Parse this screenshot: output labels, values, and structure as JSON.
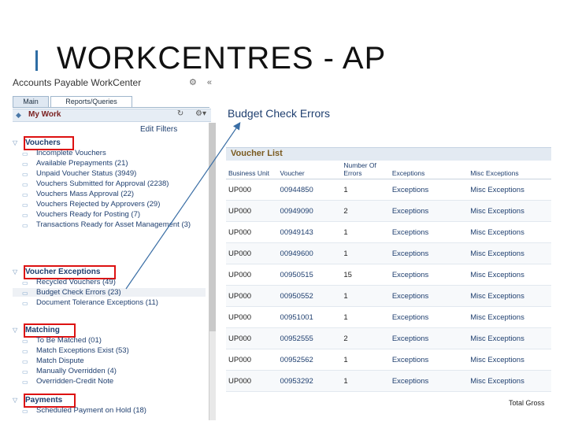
{
  "slide": {
    "title": "WORKCENTRES - AP"
  },
  "workcenter": {
    "title": "Accounts Payable WorkCenter",
    "tools": [
      "⚙",
      "«"
    ],
    "tabs": [
      "Main",
      "Reports/Queries"
    ],
    "my_work": "My Work",
    "my_work_tools": [
      "↻",
      "⚙▾"
    ],
    "edit_filters": "Edit Filters",
    "sections": [
      {
        "label": "Vouchers",
        "items": [
          "Incomplete Vouchers",
          "Available Prepayments (21)",
          "Unpaid Voucher Status (3949)",
          "Vouchers Submitted for Approval (2238)",
          "Vouchers Mass Approval (22)",
          "Vouchers Rejected by Approvers (29)",
          "Vouchers Ready for Posting (7)",
          "Transactions Ready for Asset Management (3)"
        ]
      },
      {
        "label": "Voucher Exceptions",
        "items": [
          "Recycled Vouchers (49)",
          "Budget Check Errors (23)",
          "Document Tolerance Exceptions (11)"
        ]
      },
      {
        "label": "Matching",
        "items": [
          "To Be Matched (01)",
          "Match Exceptions Exist (53)",
          "Match Dispute",
          "Manually Overridden (4)",
          "Overridden-Credit Note"
        ]
      },
      {
        "label": "Payments",
        "items": [
          "Scheduled Payment on Hold (18)"
        ]
      }
    ]
  },
  "budget_check": {
    "title": "Budget Check Errors",
    "list_title": "Voucher List",
    "columns": [
      "Business Unit",
      "Voucher",
      "Number Of Errors",
      "Exceptions",
      "Misc Exceptions"
    ],
    "rows": [
      [
        "UP000",
        "00944850",
        "1",
        "Exceptions",
        "Misc Exceptions"
      ],
      [
        "UP000",
        "00949090",
        "2",
        "Exceptions",
        "Misc Exceptions"
      ],
      [
        "UP000",
        "00949143",
        "1",
        "Exceptions",
        "Misc Exceptions"
      ],
      [
        "UP000",
        "00949600",
        "1",
        "Exceptions",
        "Misc Exceptions"
      ],
      [
        "UP000",
        "00950515",
        "15",
        "Exceptions",
        "Misc Exceptions"
      ],
      [
        "UP000",
        "00950552",
        "1",
        "Exceptions",
        "Misc Exceptions"
      ],
      [
        "UP000",
        "00951001",
        "1",
        "Exceptions",
        "Misc Exceptions"
      ],
      [
        "UP000",
        "00952555",
        "2",
        "Exceptions",
        "Misc Exceptions"
      ],
      [
        "UP000",
        "00952562",
        "1",
        "Exceptions",
        "Misc Exceptions"
      ],
      [
        "UP000",
        "00953292",
        "1",
        "Exceptions",
        "Misc Exceptions"
      ]
    ],
    "total_label": "Total Gross"
  },
  "colors": {
    "accent": "#2e6da4",
    "highlight_box": "#dd1111",
    "link": "#1f3f6f"
  }
}
